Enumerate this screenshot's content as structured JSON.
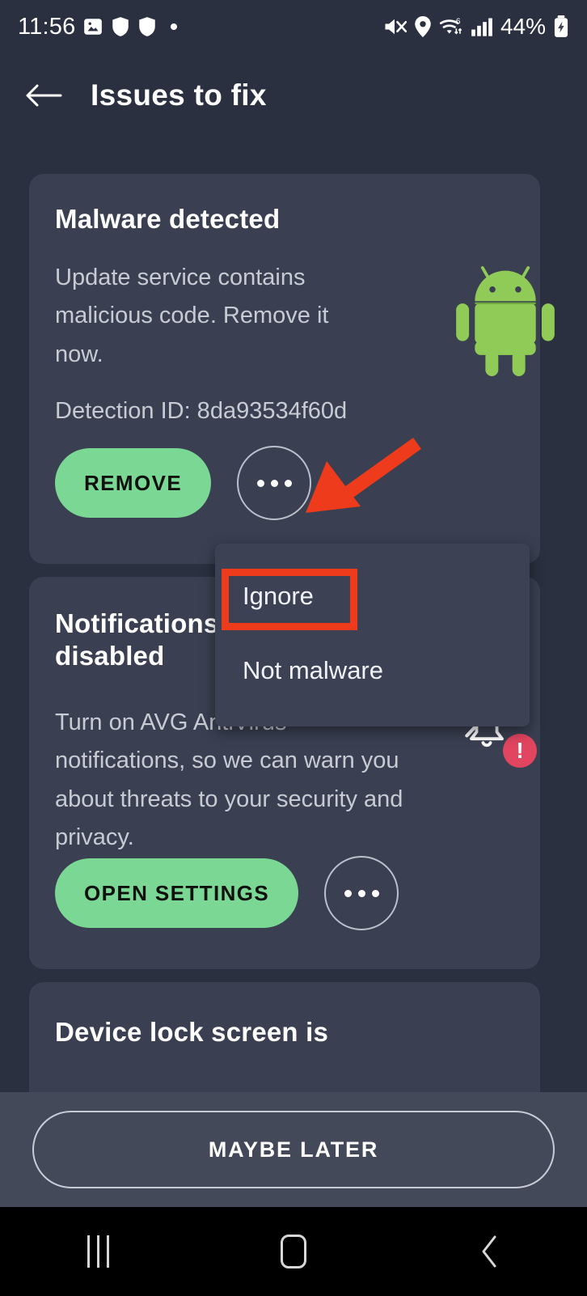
{
  "status_bar": {
    "time": "11:56",
    "battery_percent": "44%",
    "left_icons": [
      "image-icon",
      "shield-icon",
      "shield-icon",
      "dot-indicator"
    ],
    "right_icons": [
      "mute-icon",
      "location-icon",
      "wifi6-icon",
      "cellular-signal-icon",
      "battery-charging-icon"
    ]
  },
  "app_bar": {
    "back_icon": "back-arrow-icon",
    "title": "Issues to fix"
  },
  "cards": [
    {
      "title": "Malware detected",
      "body": "Update service contains malicious code. Remove it now.",
      "meta": "Detection ID: 8da93534f60d",
      "primary_label": "REMOVE",
      "more_label": "More options",
      "icon": "android-robot-icon"
    },
    {
      "title": "Notifications disabled",
      "body": "Turn on AVG AntiVirus notifications, so we can warn you about threats to your security and privacy.",
      "primary_label": "OPEN SETTINGS",
      "more_label": "More options",
      "icon": "bell-off-icon",
      "badge": "!"
    },
    {
      "title": "Device lock screen is"
    }
  ],
  "popup_menu": {
    "items": [
      {
        "label": "Ignore"
      },
      {
        "label": "Not malware"
      }
    ]
  },
  "bottom_bar": {
    "maybe_later_label": "MAYBE LATER"
  },
  "nav_bar": {
    "recents_icon": "recents-icon",
    "home_icon": "home-icon",
    "back_icon": "nav-back-icon"
  },
  "annotations": {
    "arrow_color": "#EE3B1B",
    "highlight_color": "#EE3B1B",
    "arrow_target": "more-options-button-card-1",
    "highlight_target": "menu-item-ignore"
  },
  "colors": {
    "page_background": "#2B3040",
    "card_background": "#3A4052",
    "menu_background": "#3C4254",
    "accent_green": "#7BD894",
    "badge_red": "#E2455F",
    "bottom_bar": "#434959",
    "android_green": "#8FCB56"
  }
}
